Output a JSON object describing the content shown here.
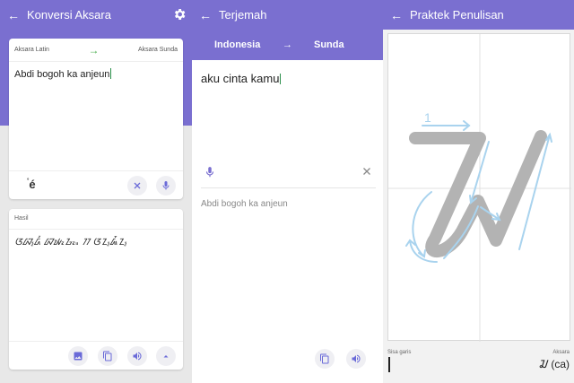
{
  "screen1": {
    "title": "Konversi Aksara",
    "source_lang": "Aksara Latin",
    "target_lang": "Aksara Sunda",
    "input_text": "Abdi bogoh ka anjeun",
    "special_char": "é",
    "special_char_mark": "°",
    "result_label": "Hasil",
    "result_text": "ᮃᮘ᮪ᮓᮤ ᮘᮚᮧᮌᮧᮂ ᮊ ᮃᮔ᮪ᮏᮩᮔ᮪"
  },
  "screen2": {
    "title": "Terjemah",
    "source_lang": "Indonesia",
    "target_lang": "Sunda",
    "input_text": "aku cinta kamu",
    "output_text": "Abdi bogoh ka anjeun"
  },
  "screen3": {
    "title": "Praktek Penulisan",
    "stroke_number": "1",
    "remaining_label": "Sisa garis",
    "aksara_label": "Aksara",
    "aksara_value": "ᮎ (ca)"
  },
  "colors": {
    "primary": "#7a6fd0",
    "accent_green": "#4caf50",
    "guide_blue": "#a9d3ee",
    "stroke_gray": "#b3b3b3"
  }
}
